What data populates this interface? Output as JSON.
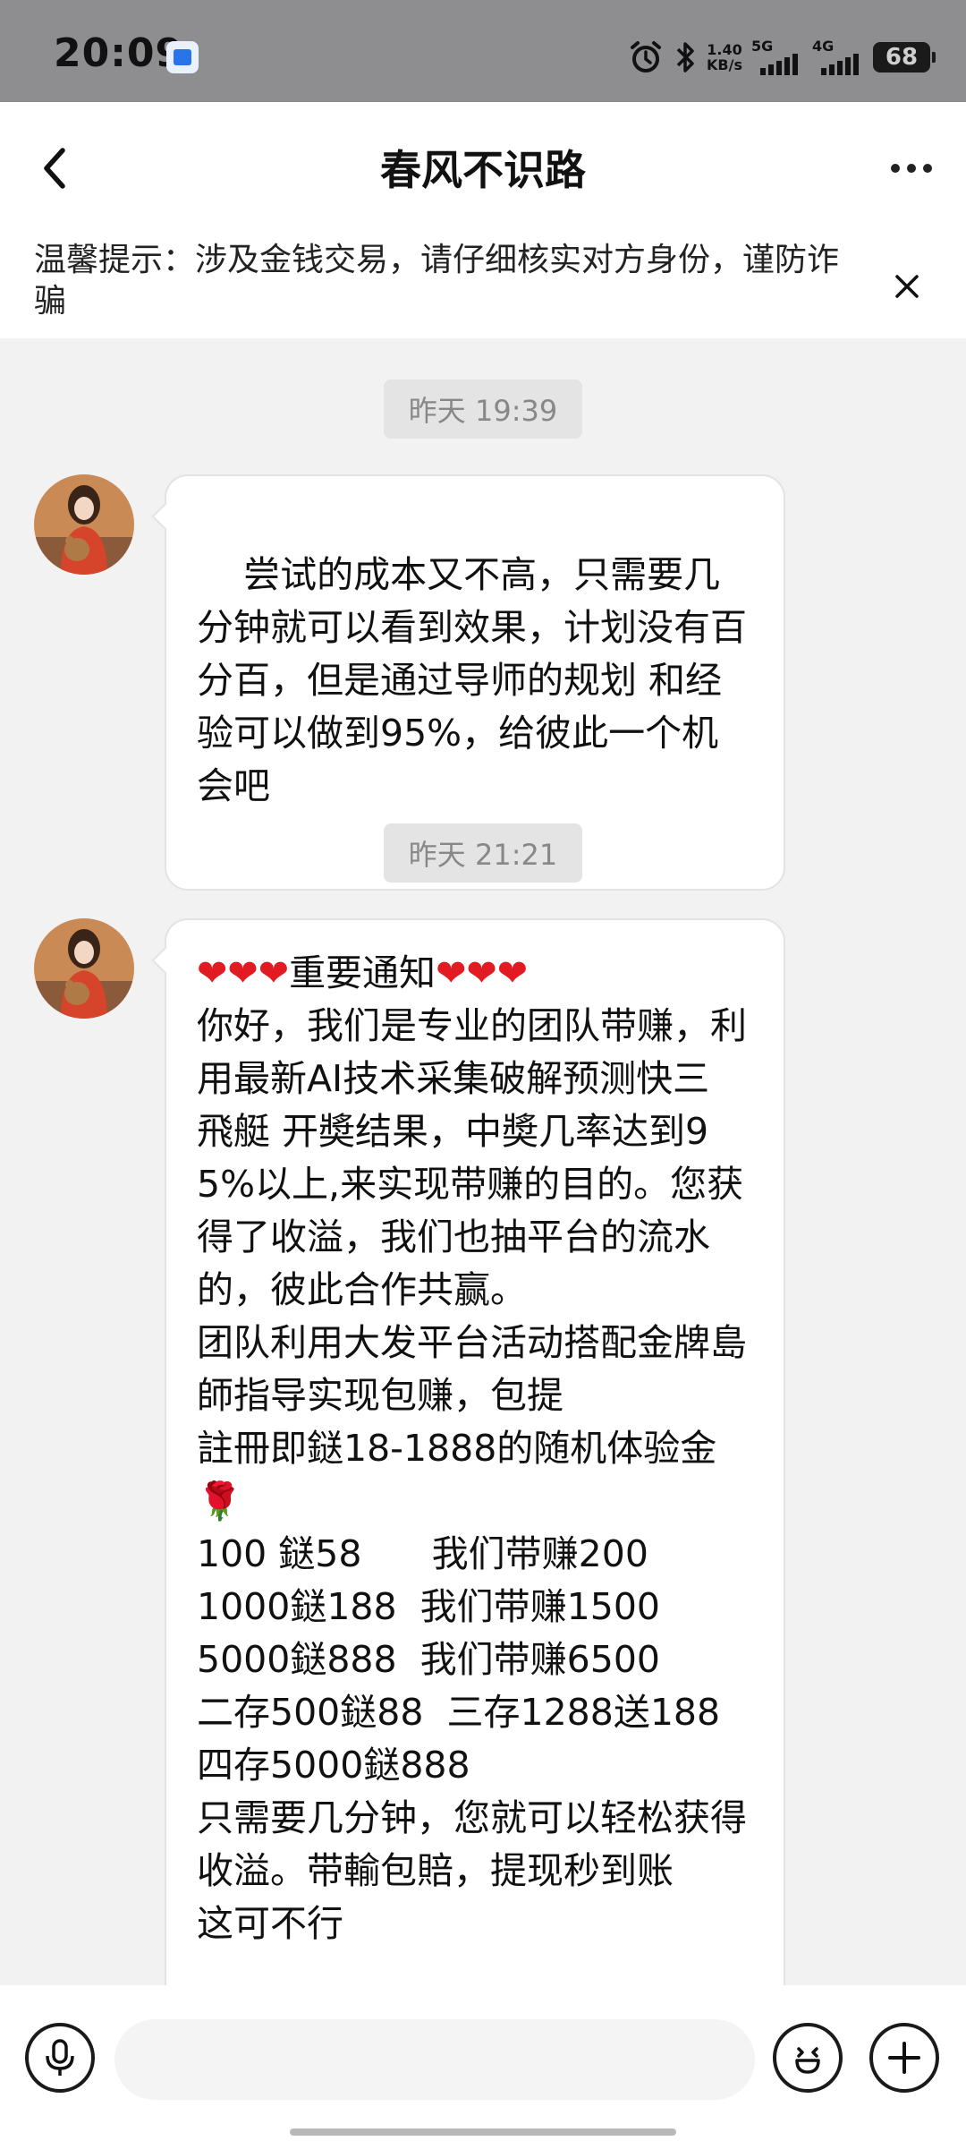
{
  "status_bar": {
    "time": "20:09",
    "speed_value": "1.40",
    "speed_unit": "KB/s",
    "net1": "5G",
    "net2": "4G",
    "battery": "68",
    "icons": [
      "app-notification-icon",
      "alarm-icon",
      "bluetooth-icon",
      "signal-icon",
      "battery-icon"
    ]
  },
  "nav": {
    "title": "春风不识路",
    "icons": [
      "back-arrow-icon",
      "more-icon"
    ]
  },
  "notice": {
    "text": "温馨提示：涉及金钱交易，请仔细核实对方身份，谨防诈骗"
  },
  "chat": {
    "messages": [
      {
        "timestamp": "昨天 19:39",
        "text": "尝试的成本又不高，只需要几分钟就可以看到效果，计划没有百分百，但是通过导师的规划 和经验可以做到95%，给彼此一个机会吧"
      },
      {
        "timestamp": "昨天 21:21",
        "hearts_left": "❤❤❤",
        "heading": "重要通知",
        "hearts_right": "❤❤❤",
        "text": "你好，我们是专业的团队带赚，利用最新AI技术采集破解预测快三 飛艇 开奬结果，中奬几率达到95%以上,来实现带赚的目的。您获得了收溢，我们也抽平台的流水的，彼此合作共赢。\n团队利用大发平台活动搭配金牌島師指导实现包赚，包提\n註冊即鎹18-1888的随机体验金\n🌹\n100 鎹58      我们带赚200\n1000鎹188  我们带赚1500\n5000鎹888  我们带赚6500\n二存500鎹88  三存1288送188\n四存5000鎹888\n只需要几分钟，您就可以轻松获得收溢。带輸包賠，提现秒到账\n这可不行"
      }
    ]
  },
  "input_bar": {
    "placeholder": "",
    "icons": [
      "voice-icon",
      "emoji-icon",
      "add-icon"
    ]
  }
}
